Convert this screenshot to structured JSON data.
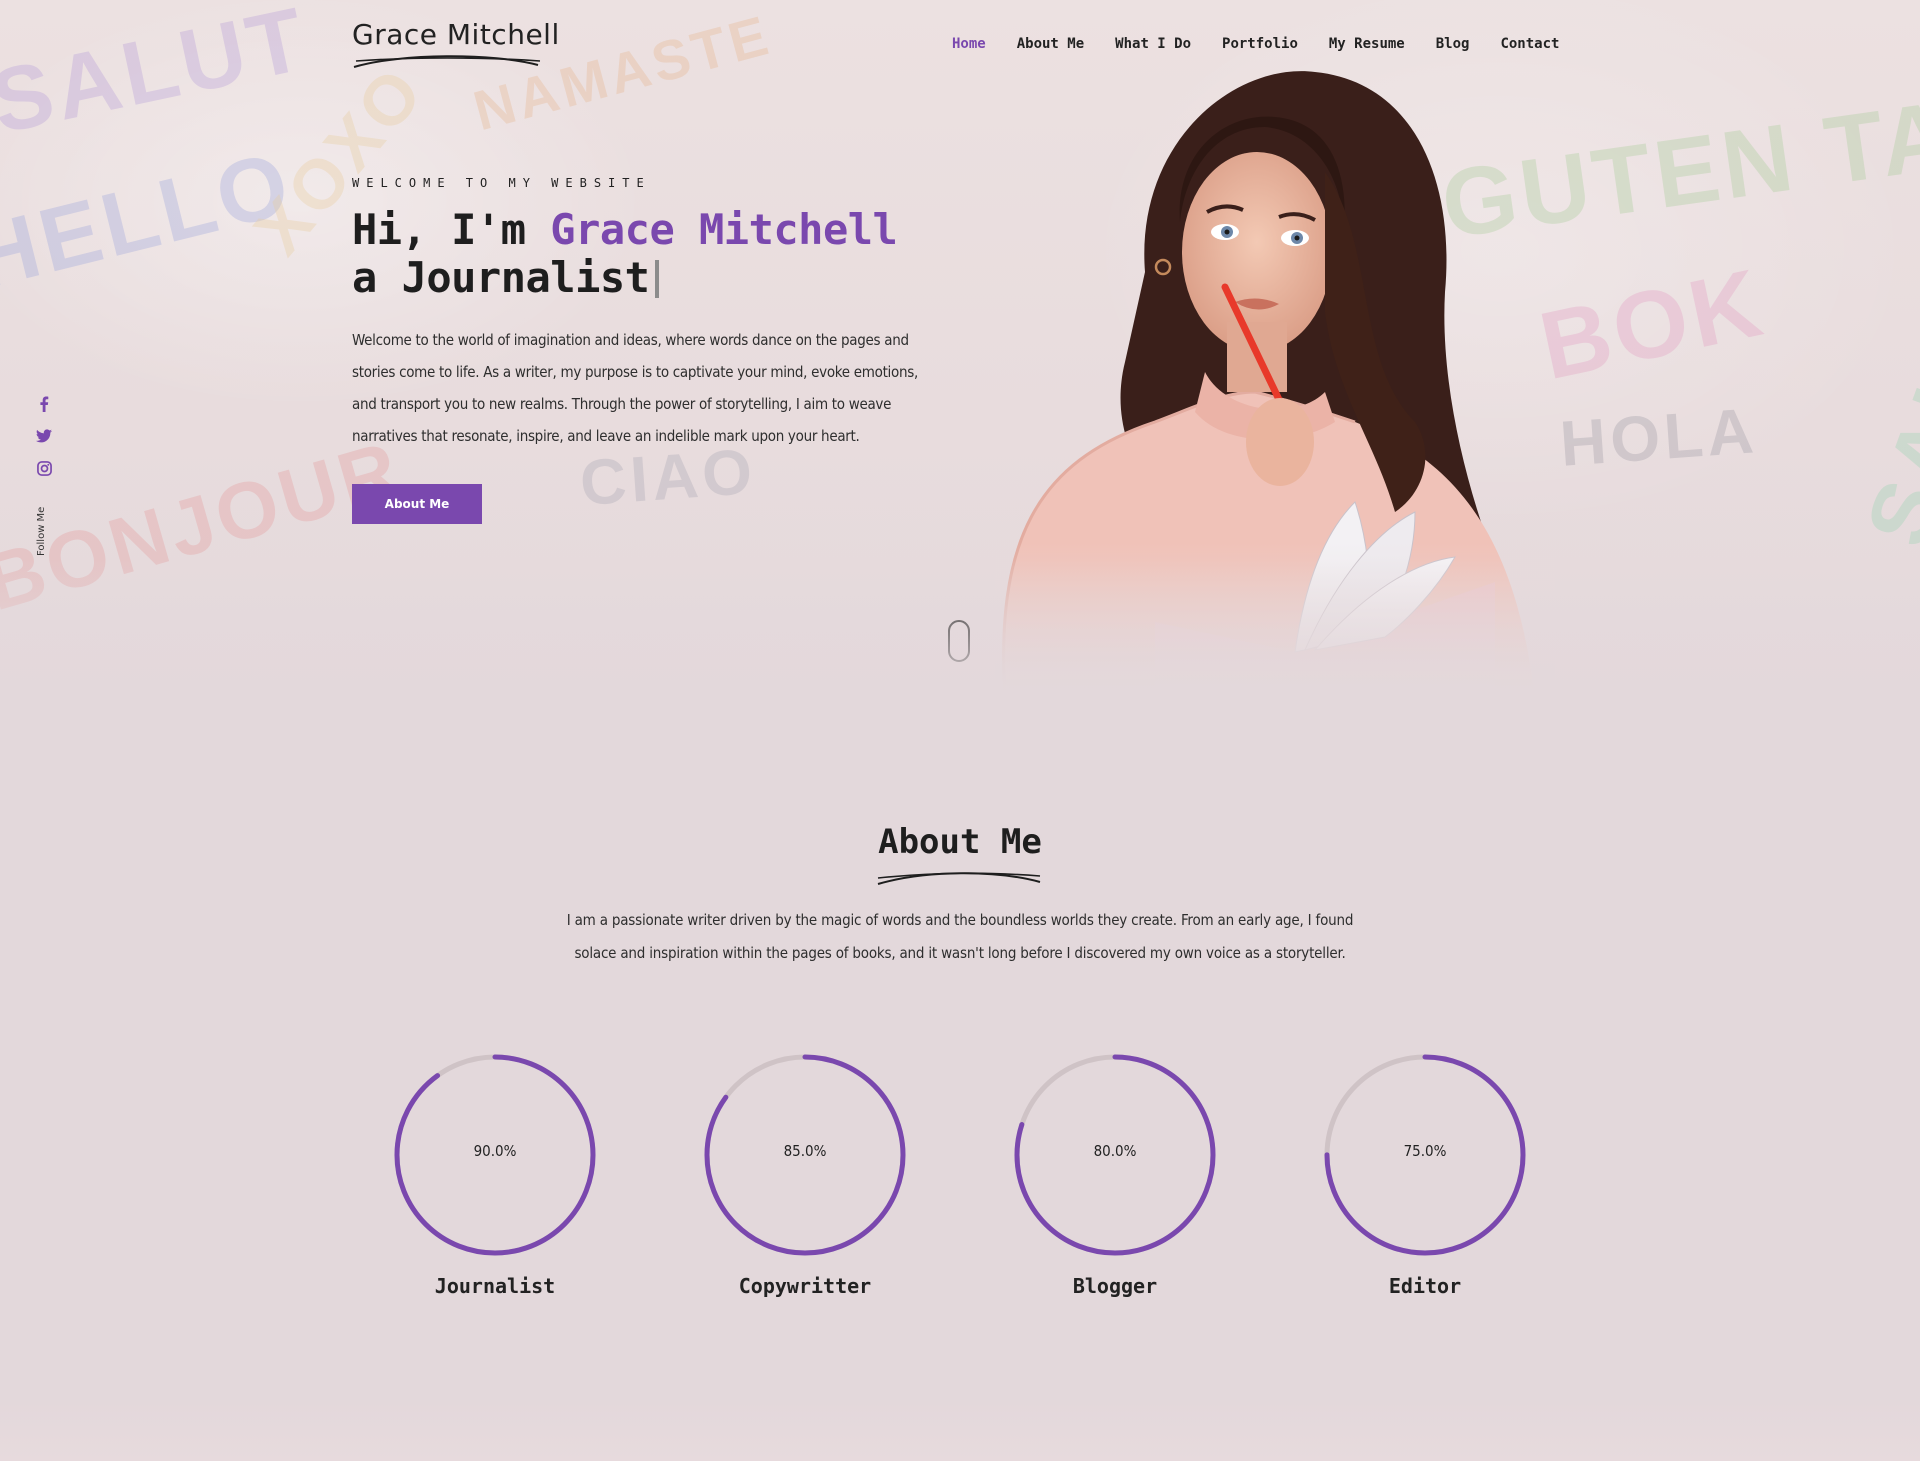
{
  "header": {
    "logo": "Grace Mitchell",
    "nav": [
      {
        "label": "Home",
        "active": true
      },
      {
        "label": "About Me",
        "active": false
      },
      {
        "label": "What I Do",
        "active": false
      },
      {
        "label": "Portfolio",
        "active": false
      },
      {
        "label": "My Resume",
        "active": false
      },
      {
        "label": "Blog",
        "active": false
      },
      {
        "label": "Contact",
        "active": false
      }
    ]
  },
  "hero": {
    "eyebrow": "WELCOME TO MY WEBSITE",
    "greeting": "Hi, I'm ",
    "name": "Grace Mitchell",
    "role_line": "a Journalist",
    "intro": "Welcome to the world of imagination and ideas, where words dance on the pages and stories come to life. As a writer, my purpose is to captivate your mind, evoke emotions, and transport you to new realms. Through the power of storytelling, I aim to weave narratives that resonate, inspire, and leave an indelible mark upon your heart.",
    "cta_label": "About Me",
    "background_words": [
      "SALUT",
      "HELLO",
      "NAMASTE",
      "GUTEN TAG",
      "BOK",
      "HOLA",
      "SALUT",
      "XOXO",
      "BONJOUR",
      "CIAO"
    ]
  },
  "social": {
    "icons": [
      "facebook-icon",
      "twitter-icon",
      "instagram-icon"
    ],
    "follow_label": "Follow Me"
  },
  "about": {
    "title": "About Me",
    "text": "I am a passionate writer driven by the magic of words and the boundless worlds they create. From an early age, I found solace and inspiration within the pages of books, and it wasn't long before I discovered my own voice as a storyteller.",
    "skills": [
      {
        "label": "Journalist",
        "percent": 90,
        "display": "90.0%"
      },
      {
        "label": "Copywritter",
        "percent": 85,
        "display": "85.0%"
      },
      {
        "label": "Blogger",
        "percent": 80,
        "display": "80.0%"
      },
      {
        "label": "Editor",
        "percent": 75,
        "display": "75.0%"
      }
    ]
  },
  "colors": {
    "accent": "#7a48ae",
    "track": "#cfc3c6",
    "background": "#e3d8db",
    "text": "#1e1e1e"
  }
}
